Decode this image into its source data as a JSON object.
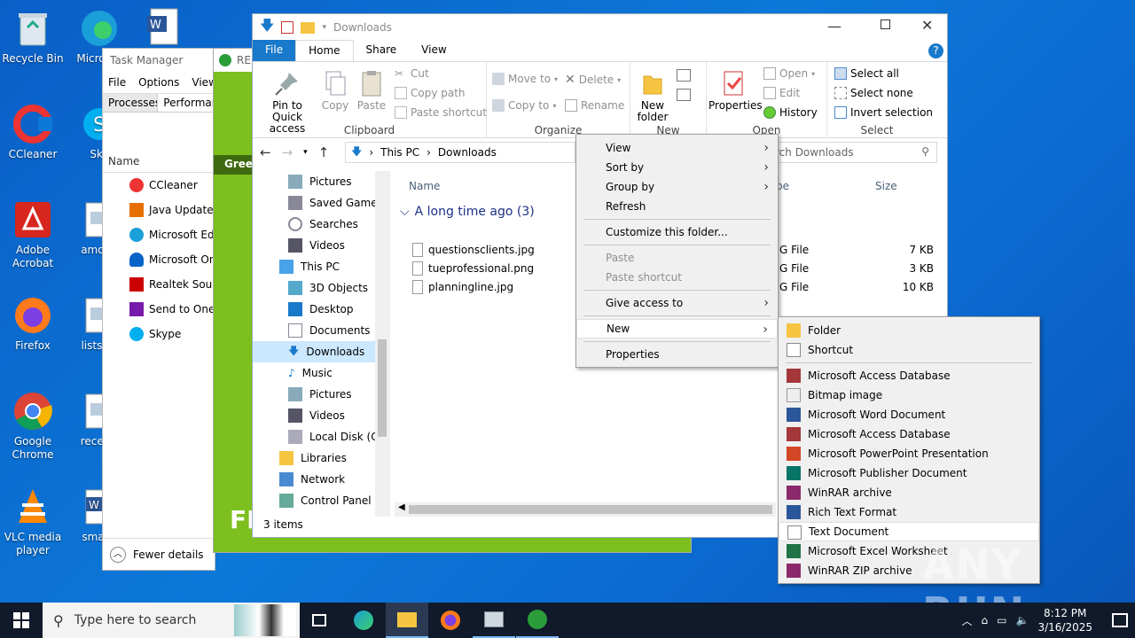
{
  "desktop": {
    "icons": [
      {
        "label": "Recycle Bin"
      },
      {
        "label": "Micro Ed"
      },
      {
        "label": "CCleaner"
      },
      {
        "label": "Sky"
      },
      {
        "label": "Adobe Acrobat"
      },
      {
        "label": "among"
      },
      {
        "label": "Firefox"
      },
      {
        "label": "listswo"
      },
      {
        "label": "Google Chrome"
      },
      {
        "label": "recentf"
      },
      {
        "label": "VLC media player"
      },
      {
        "label": "smalle"
      }
    ]
  },
  "task_manager": {
    "title": "Task Manager",
    "menu": [
      "File",
      "Options",
      "View"
    ],
    "tabs": [
      "Processes",
      "Performan"
    ],
    "column": "Name",
    "apps": [
      "CCleaner",
      "Java Update Sc",
      "Microsoft Edg",
      "Microsoft One",
      "Realtek Sound",
      "Send to OneN",
      "Skype"
    ],
    "fewer_details": "Fewer details"
  },
  "ftp_window": {
    "title": "REF",
    "banner": "Gree",
    "bottom_text": "FR"
  },
  "explorer": {
    "title": "Downloads",
    "ribbon_tabs": [
      "File",
      "Home",
      "Share",
      "View"
    ],
    "clipboard": {
      "pin": "Pin to Quick access",
      "copy": "Copy",
      "paste": "Paste",
      "cut": "Cut",
      "copy_path": "Copy path",
      "paste_shortcut": "Paste shortcut",
      "label": "Clipboard"
    },
    "organize": {
      "move_to": "Move to",
      "copy_to": "Copy to",
      "delete": "Delete",
      "rename": "Rename",
      "label": "Organize"
    },
    "new": {
      "new_folder": "New folder",
      "label": "New"
    },
    "open": {
      "properties": "Properties",
      "open": "Open",
      "edit": "Edit",
      "history": "History",
      "label": "Open"
    },
    "select": {
      "select_all": "Select all",
      "select_none": "Select none",
      "invert": "Invert selection",
      "label": "Select"
    },
    "breadcrumb": [
      "This PC",
      "Downloads"
    ],
    "search_placeholder": "rch Downloads",
    "nav": [
      "Pictures",
      "Saved Games",
      "Searches",
      "Videos",
      "This PC",
      "3D Objects",
      "Desktop",
      "Documents",
      "Downloads",
      "Music",
      "Pictures",
      "Videos",
      "Local Disk (C:)",
      "Libraries",
      "Network",
      "Control Panel"
    ],
    "columns": {
      "name": "Name",
      "type": "pe",
      "size": "Size"
    },
    "group": "A long time ago (3)",
    "files": [
      {
        "name": "questionsclients.jpg",
        "type": "G File",
        "size": "7 KB"
      },
      {
        "name": "tueprofessional.png",
        "type": "G File",
        "size": "3 KB"
      },
      {
        "name": "planningline.jpg",
        "type": "G File",
        "size": "10 KB"
      }
    ],
    "status": "3 items"
  },
  "context_menu": {
    "items": [
      "View",
      "Sort by",
      "Group by",
      "Refresh",
      "Customize this folder...",
      "Paste",
      "Paste shortcut",
      "Give access to",
      "New",
      "Properties"
    ]
  },
  "new_submenu": {
    "items": [
      "Folder",
      "Shortcut",
      "Microsoft Access Database",
      "Bitmap image",
      "Microsoft Word Document",
      "Microsoft Access Database",
      "Microsoft PowerPoint Presentation",
      "Microsoft Publisher Document",
      "WinRAR archive",
      "Rich Text Format",
      "Text Document",
      "Microsoft Excel Worksheet",
      "WinRAR ZIP archive"
    ]
  },
  "taskbar": {
    "search_placeholder": "Type here to search",
    "time": "8:12 PM",
    "date": "3/16/2025"
  },
  "watermark": "ANY RUN",
  "colors": {
    "accent": "#1979ca",
    "selection": "#cce8ff",
    "desktop": "#0c78d8"
  }
}
